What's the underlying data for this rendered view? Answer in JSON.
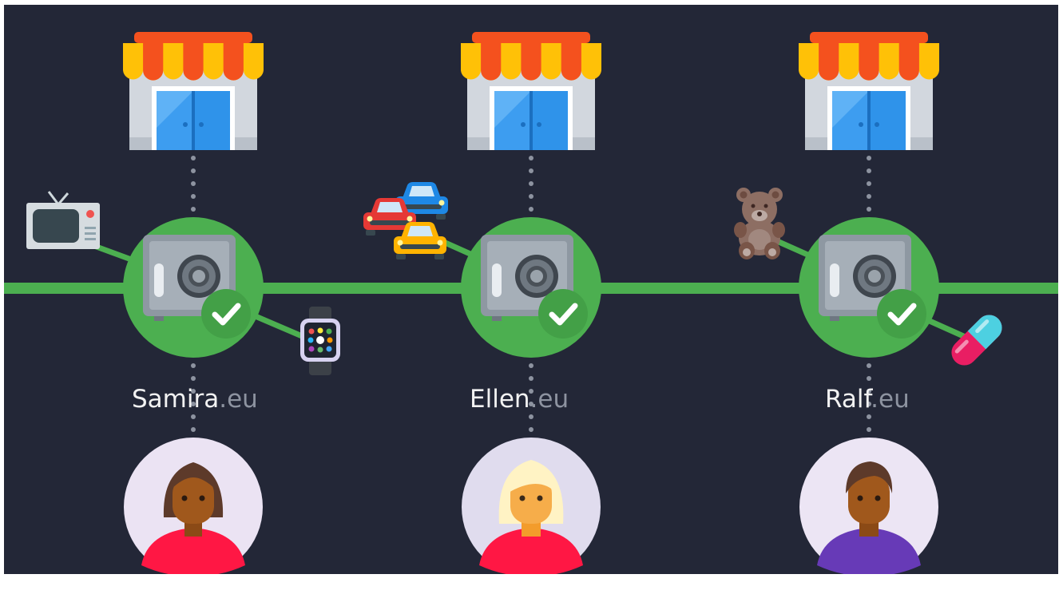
{
  "colors": {
    "background": "#232737",
    "network_green": "#4caf50",
    "check_green": "#43a047",
    "domain_name": "#f2f2f2",
    "domain_tld": "#8d93a0",
    "avatar_bg": "#ebe3f3"
  },
  "nodes": [
    {
      "name": "Samira",
      "tld": ".eu",
      "icons": [
        "store-icon",
        "safe-icon",
        "checkmark-icon",
        "avatar-woman-dark-hair"
      ],
      "products": [
        "tv-icon",
        "smartwatch-icon"
      ]
    },
    {
      "name": "Ellen",
      "tld": ".eu",
      "icons": [
        "store-icon",
        "safe-icon",
        "checkmark-icon",
        "avatar-woman-blonde"
      ],
      "products": [
        "cars-icon"
      ]
    },
    {
      "name": "Ralf",
      "tld": ".eu",
      "icons": [
        "store-icon",
        "safe-icon",
        "checkmark-icon",
        "avatar-man"
      ],
      "products": [
        "teddy-bear-icon",
        "pill-icon"
      ]
    }
  ]
}
